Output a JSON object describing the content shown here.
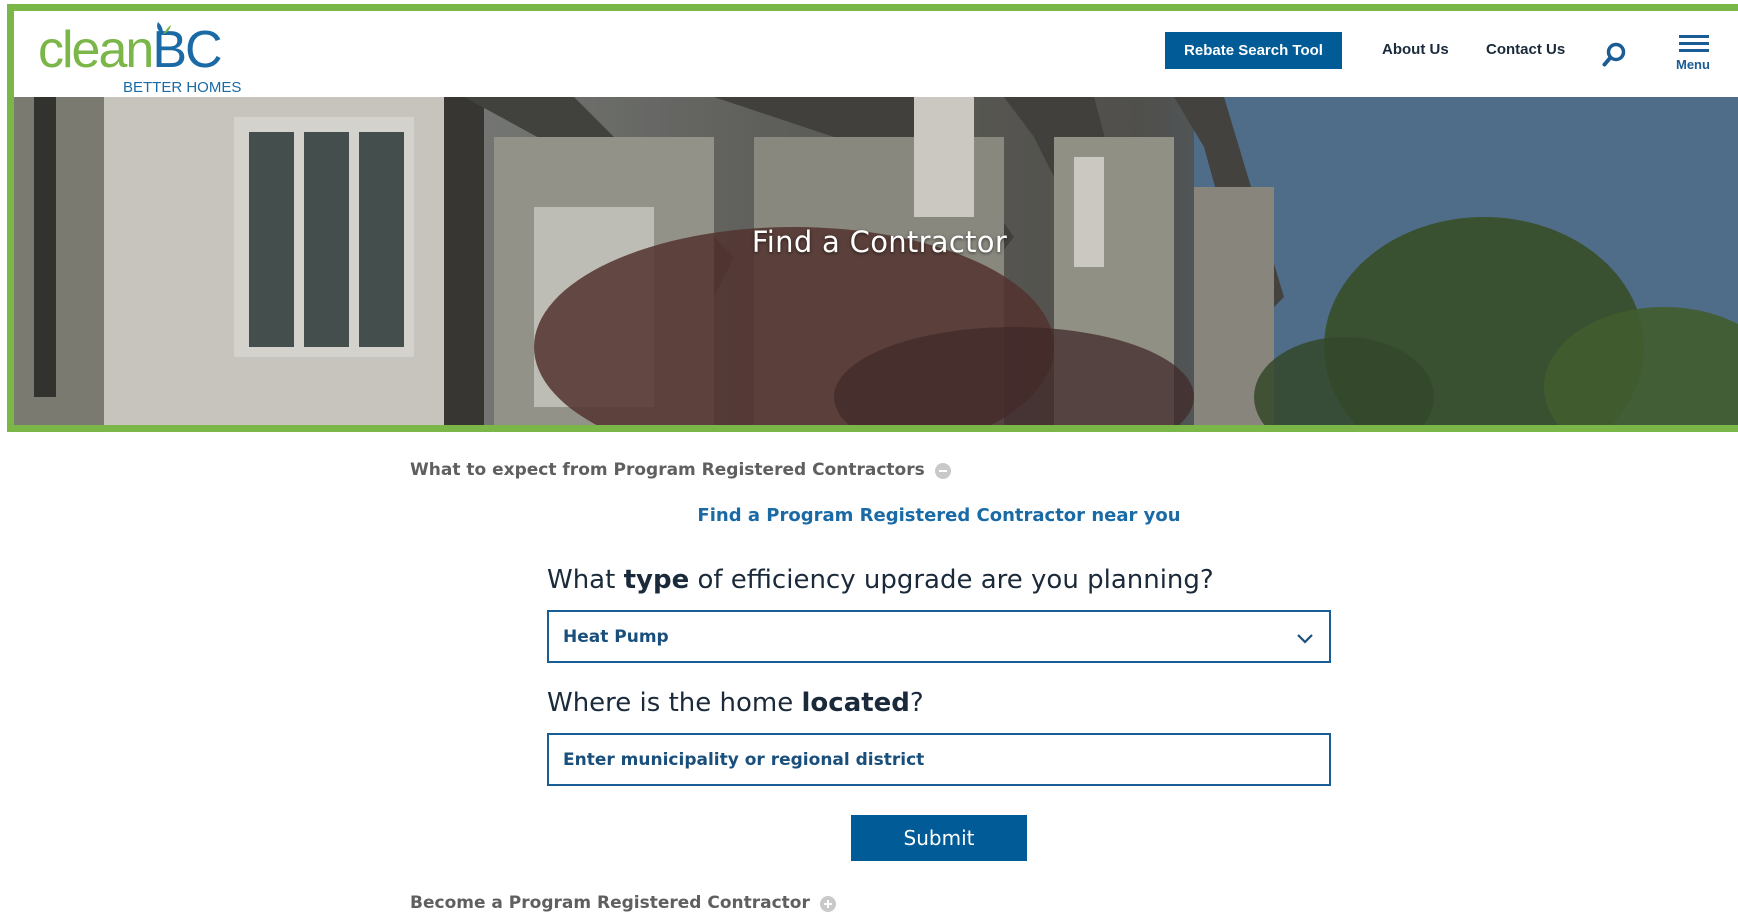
{
  "brand": {
    "logo_clean": "clean",
    "logo_bc": "BC",
    "logo_sub": "BETTER HOMES",
    "colors": {
      "green": "#7ab648",
      "blue": "#1a6aa5",
      "button": "#005b96"
    }
  },
  "header": {
    "rebate_button": "Rebate Search Tool",
    "nav": {
      "about": "About Us",
      "contact": "Contact Us"
    },
    "search_icon": "search-icon",
    "menu_label": "Menu"
  },
  "hero": {
    "title": "Find a Contractor"
  },
  "main": {
    "expect_toggle": "What to expect from Program Registered Contractors",
    "find_link": "Find a Program Registered Contractor near you",
    "question_type": {
      "pre": "What ",
      "bold": "type",
      "post": " of efficiency upgrade are you planning?"
    },
    "upgrade_select": {
      "value": "Heat Pump"
    },
    "question_location": {
      "pre": "Where is the home ",
      "bold": "located",
      "post": "?"
    },
    "location_input": {
      "placeholder": "Enter municipality or regional district",
      "value": ""
    },
    "submit": "Submit",
    "become_toggle": "Become a Program Registered Contractor"
  }
}
